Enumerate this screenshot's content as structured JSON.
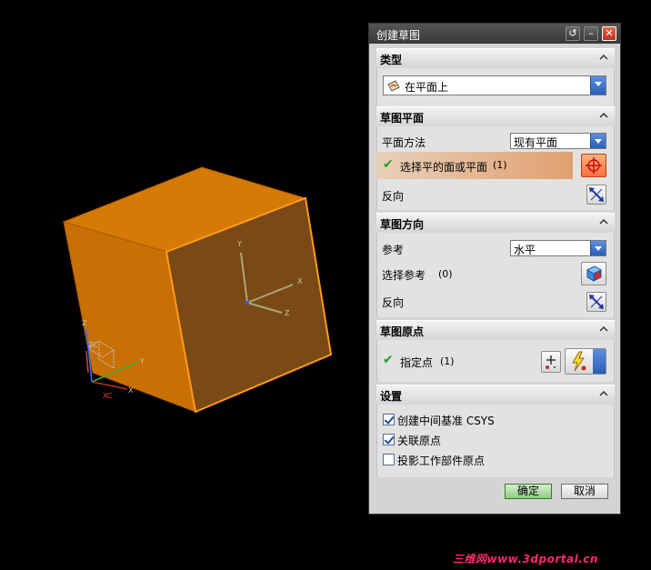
{
  "viewport": {
    "axes_small": {
      "zc": "ZC",
      "z": "Z",
      "y": "Y",
      "xc": "XC",
      "x": "X"
    },
    "axes_face": {
      "y": "Y",
      "x": "X",
      "z": "Z"
    },
    "colors": {
      "cube_top": "#d67a06",
      "cube_left": "#c97005",
      "cube_face": "#7a4a16",
      "edge": "#ff9a1a"
    }
  },
  "dialog": {
    "title": "创建草图",
    "sections": {
      "type": {
        "title": "类型",
        "selected": "在平面上"
      },
      "sketch_plane": {
        "title": "草图平面",
        "plane_method_label": "平面方法",
        "plane_method_value": "现有平面",
        "select_label": "选择平的面或平面",
        "select_count": "(1)",
        "reverse_label": "反向"
      },
      "sketch_orientation": {
        "title": "草图方向",
        "reference_label": "参考",
        "reference_value": "水平",
        "select_ref_label": "选择参考",
        "select_ref_count": "(0)",
        "reverse_label": "反向"
      },
      "sketch_origin": {
        "title": "草图原点",
        "specify_point_label": "指定点",
        "specify_point_count": "(1)"
      },
      "settings": {
        "title": "设置",
        "options": [
          {
            "label": "创建中间基准 CSYS",
            "checked": true
          },
          {
            "label": "关联原点",
            "checked": true
          },
          {
            "label": "投影工作部件原点",
            "checked": false
          }
        ]
      }
    },
    "ok_label": "确定",
    "cancel_label": "取消"
  },
  "watermark": "三维网www.3dportal.cn"
}
